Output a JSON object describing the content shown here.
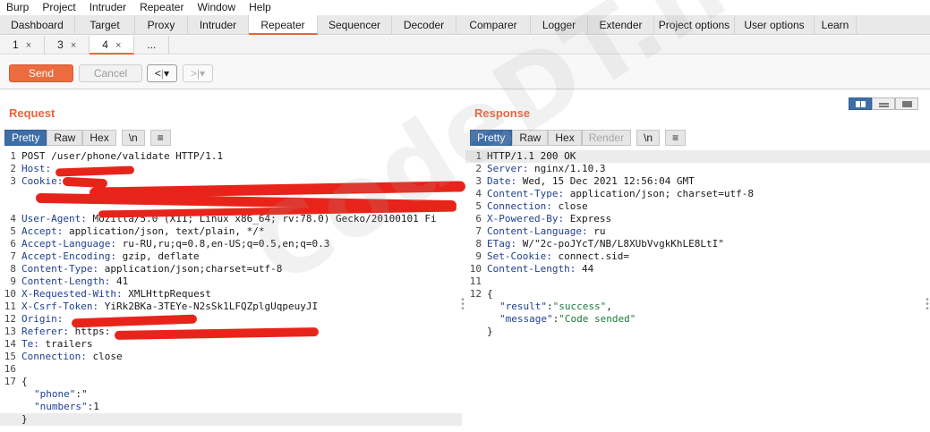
{
  "menu": [
    "Burp",
    "Project",
    "Intruder",
    "Repeater",
    "Window",
    "Help"
  ],
  "tabs": [
    "Dashboard",
    "Target",
    "Proxy",
    "Intruder",
    "Repeater",
    "Sequencer",
    "Decoder",
    "Comparer",
    "Logger",
    "Extender",
    "Project options",
    "User options",
    "Learn"
  ],
  "active_tab": "Repeater",
  "subtabs": [
    {
      "label": "1",
      "close": "×"
    },
    {
      "label": "3",
      "close": "×"
    },
    {
      "label": "4",
      "close": "×"
    },
    {
      "label": "...",
      "close": ""
    }
  ],
  "toolbar": {
    "send_label": "Send",
    "cancel_label": "Cancel",
    "back_label": "<",
    "back_menu": "▾",
    "forward_label": ">",
    "forward_menu": "▾"
  },
  "request": {
    "title": "Request",
    "format_tabs": [
      "Pretty",
      "Raw",
      "Hex"
    ],
    "newline_label": "\\n",
    "menu_label": "≡",
    "lines": [
      {
        "n": "1",
        "text": "POST /user/phone/validate HTTP/1.1",
        "type": "plain"
      },
      {
        "n": "2",
        "key": "Host:",
        "text": "",
        "type": "header"
      },
      {
        "n": "3",
        "key": "Cookie:",
        "text": "",
        "type": "header"
      },
      {
        "n": "",
        "text": "",
        "type": "plain"
      },
      {
        "n": "",
        "text": "",
        "type": "plain"
      },
      {
        "n": "4",
        "key": "User-Agent:",
        "text": " Mozilla/5.0 (X11; Linux x86_64; rv:78.0) Gecko/20100101 Fi",
        "type": "header"
      },
      {
        "n": "5",
        "key": "Accept:",
        "text": " application/json, text/plain, */*",
        "type": "header"
      },
      {
        "n": "6",
        "key": "Accept-Language:",
        "text": " ru-RU,ru;q=0.8,en-US;q=0.5,en;q=0.3",
        "type": "header"
      },
      {
        "n": "7",
        "key": "Accept-Encoding:",
        "text": " gzip, deflate",
        "type": "header"
      },
      {
        "n": "8",
        "key": "Content-Type:",
        "text": " application/json;charset=utf-8",
        "type": "header"
      },
      {
        "n": "9",
        "key": "Content-Length:",
        "text": " 41",
        "type": "header"
      },
      {
        "n": "10",
        "key": "X-Requested-With:",
        "text": " XMLHttpRequest",
        "type": "header"
      },
      {
        "n": "11",
        "key": "X-Csrf-Token:",
        "text": " YiRk2BKa-3TEYe-N2sSk1LFQZplgUqpeuyJI",
        "type": "header"
      },
      {
        "n": "12",
        "key": "Origin:",
        "text": "",
        "type": "header"
      },
      {
        "n": "13",
        "key": "Referer:",
        "text": " https:",
        "type": "header"
      },
      {
        "n": "14",
        "key": "Te:",
        "text": " trailers",
        "type": "header"
      },
      {
        "n": "15",
        "key": "Connection:",
        "text": " close",
        "type": "header"
      },
      {
        "n": "16",
        "text": "",
        "type": "plain"
      },
      {
        "n": "17",
        "text": "{",
        "type": "plain"
      },
      {
        "n": "",
        "jkey": "\"phone\"",
        "text": ":\"",
        "type": "json"
      },
      {
        "n": "",
        "jkey": "\"numbers\"",
        "text": ":1",
        "type": "json"
      },
      {
        "n": "",
        "text": "}",
        "type": "hl"
      }
    ]
  },
  "response": {
    "title": "Response",
    "format_tabs": [
      "Pretty",
      "Raw",
      "Hex",
      "Render"
    ],
    "newline_label": "\\n",
    "menu_label": "≡",
    "lines": [
      {
        "n": "1",
        "text": "HTTP/1.1 200 OK",
        "type": "hl"
      },
      {
        "n": "2",
        "key": "Server:",
        "text": " nginx/1.10.3",
        "type": "header"
      },
      {
        "n": "3",
        "key": "Date:",
        "text": " Wed, 15 Dec 2021 12:56:04 GMT",
        "type": "header"
      },
      {
        "n": "4",
        "key": "Content-Type:",
        "text": " application/json; charset=utf-8",
        "type": "header"
      },
      {
        "n": "5",
        "key": "Connection:",
        "text": " close",
        "type": "header"
      },
      {
        "n": "6",
        "key": "X-Powered-By:",
        "text": " Express",
        "type": "header"
      },
      {
        "n": "7",
        "key": "Content-Language:",
        "text": " ru",
        "type": "header"
      },
      {
        "n": "8",
        "key": "ETag:",
        "text": " W/\"2c-poJYcT/NB/L8XUbVvgkKhLE8LtI\"",
        "type": "header"
      },
      {
        "n": "9",
        "key": "Set-Cookie:",
        "text": " connect.sid=",
        "type": "header"
      },
      {
        "n": "10",
        "key": "Content-Length:",
        "text": " 44",
        "type": "header"
      },
      {
        "n": "11",
        "text": "",
        "type": "plain"
      },
      {
        "n": "12",
        "text": "{",
        "type": "plain"
      },
      {
        "n": "",
        "jkey": "\"result\"",
        "text": ":",
        "jval": "\"success\"",
        "tail": ",",
        "type": "json"
      },
      {
        "n": "",
        "jkey": "\"message\"",
        "text": ":",
        "jval": "\"Code sended\"",
        "tail": "",
        "type": "json"
      },
      {
        "n": "",
        "text": "}",
        "type": "plain"
      }
    ]
  },
  "icons": {
    "close": "close-icon",
    "dropdown": "chevron-down-icon",
    "menu": "hamburger-icon",
    "layout": "layout-split-icon"
  },
  "watermark": "CodeDT.net",
  "colors": {
    "accent": "#e8643c",
    "selected": "#3d6ea8",
    "header_key": "#1f3f8f",
    "json_string": "#1b7a3a",
    "redaction": "#e8241a"
  }
}
